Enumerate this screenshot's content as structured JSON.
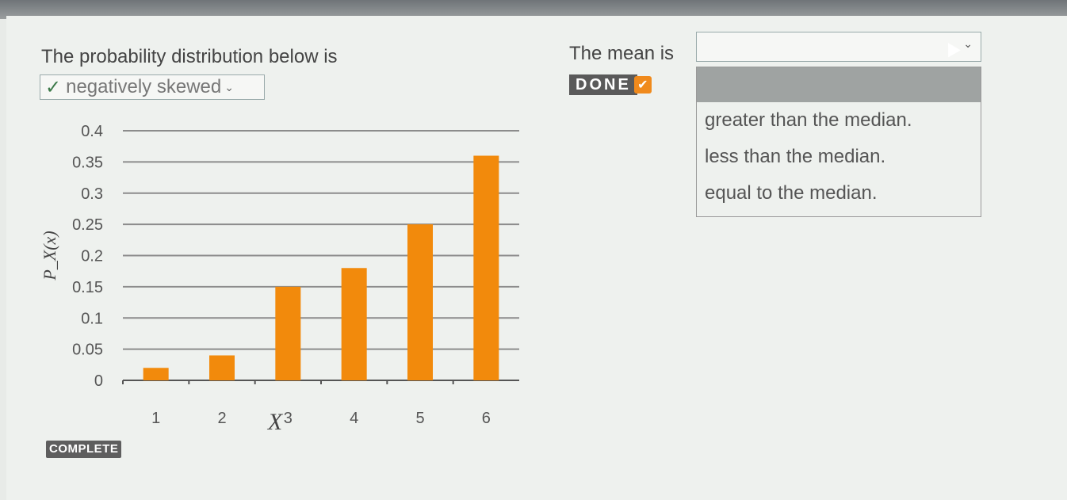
{
  "question1": {
    "text": "The probability distribution below is",
    "selected_check": "✓",
    "selected_value": "negatively skewed",
    "chevron": "⌄"
  },
  "question2": {
    "text": "The mean is",
    "selected_value": "",
    "chevron": "⌄",
    "done_label": "DONE",
    "done_check": "✔",
    "options": [
      "greater than the median.",
      "less than the median.",
      "equal to the median."
    ]
  },
  "complete_label": "COMPLETE",
  "chart_data": {
    "type": "bar",
    "categories": [
      "1",
      "2",
      "3",
      "4",
      "5",
      "6"
    ],
    "values": [
      0.02,
      0.04,
      0.15,
      0.18,
      0.25,
      0.36
    ],
    "xlabel": "X",
    "ylabel": "P_X(x)",
    "ylim": [
      0,
      0.4
    ],
    "yticks": [
      "0",
      "0.05",
      "0.1",
      "0.15",
      "0.2",
      "0.25",
      "0.3",
      "0.35",
      "0.4"
    ],
    "grid": true,
    "bar_color": "#f28a0c"
  },
  "colors": {
    "accent": "#f08a1c",
    "badge": "#5a5a5a"
  }
}
